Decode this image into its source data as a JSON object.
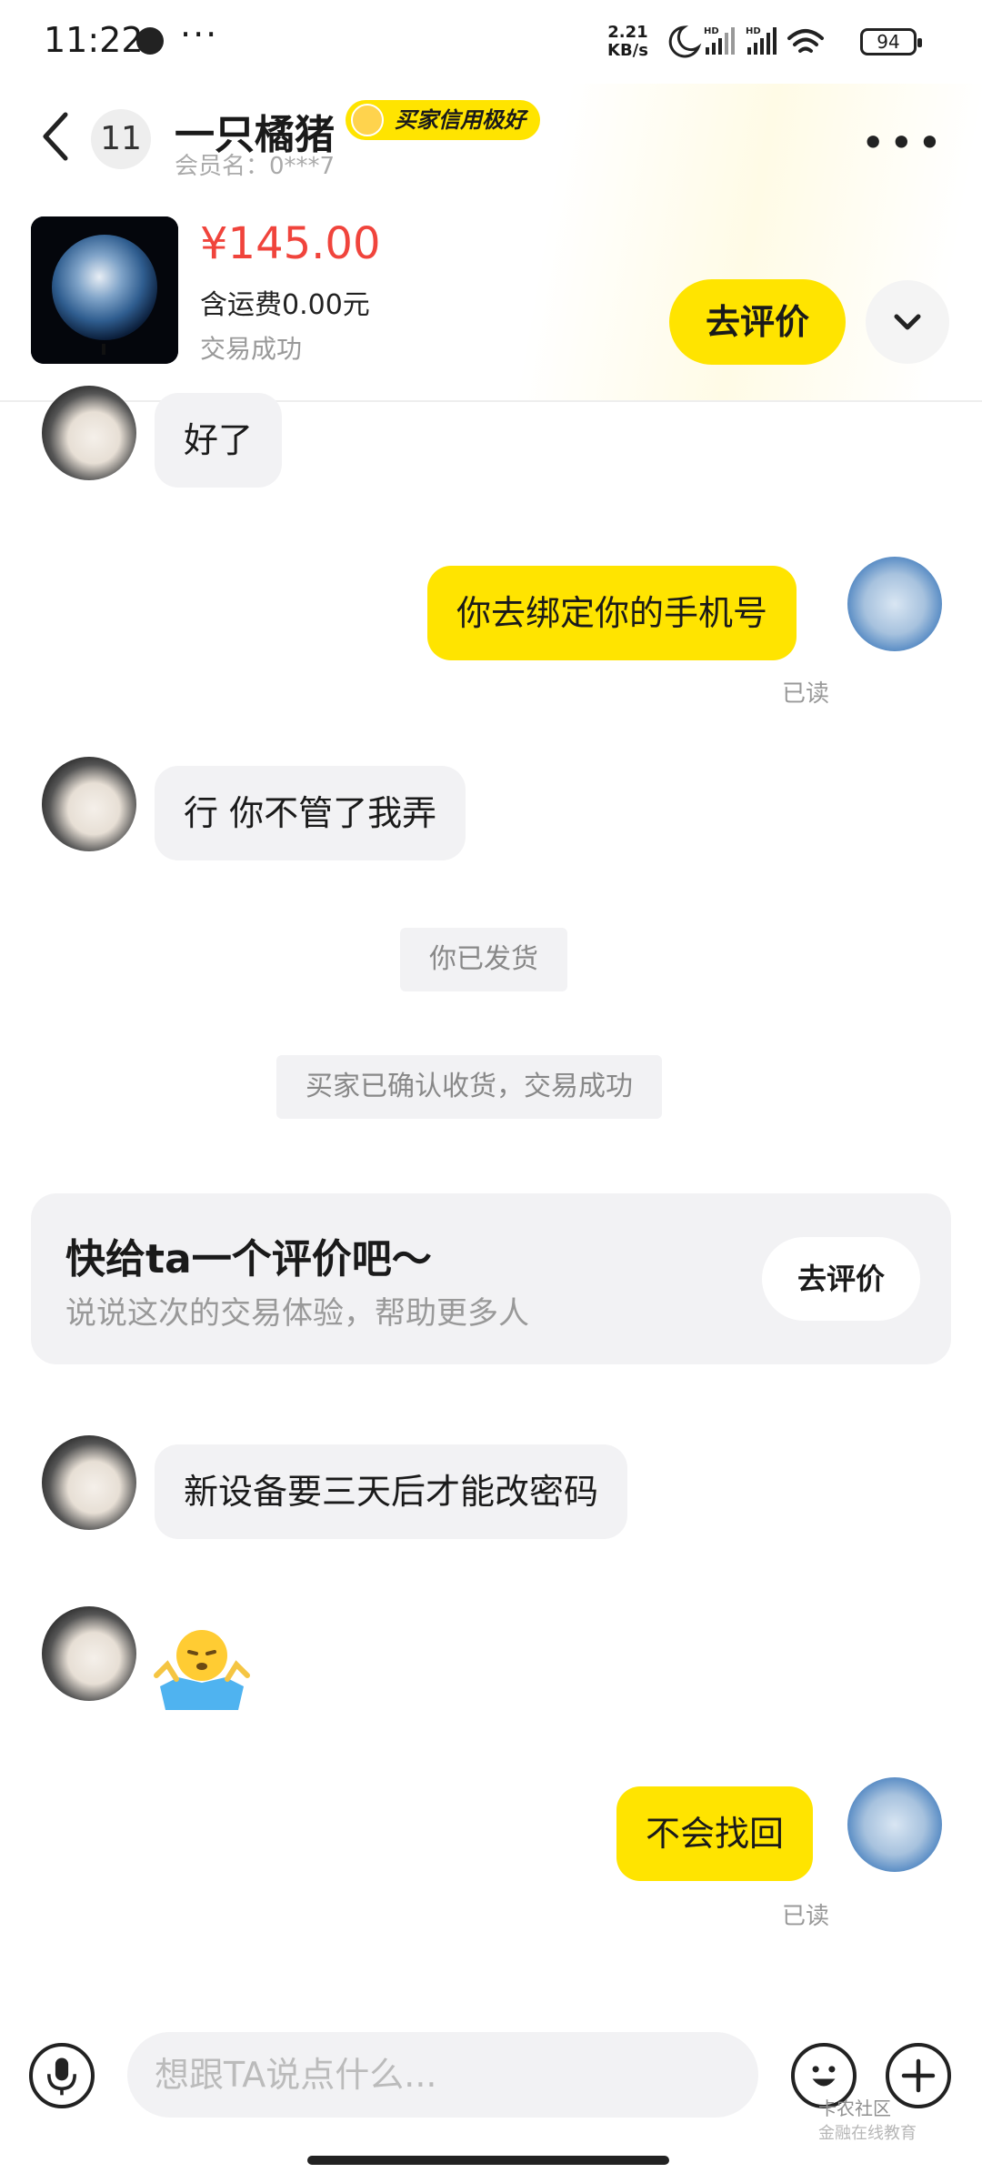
{
  "status_bar": {
    "time": "11:22",
    "more": "···",
    "speed_value": "2.21",
    "speed_unit": "KB/s",
    "battery": "94"
  },
  "header": {
    "unread_count": "11",
    "nickname": "一只橘猪",
    "credit_badge": "买家信用极好",
    "member_label": "会员名：0***7"
  },
  "product": {
    "price": "¥145.00",
    "shipping": "含运费0.00元",
    "status": "交易成功",
    "review_button": "去评价"
  },
  "messages": [
    {
      "side": "left",
      "text": "好了"
    },
    {
      "side": "right",
      "text": "你去绑定你的手机号",
      "read": "已读"
    },
    {
      "side": "left",
      "text": "行 你不管了我弄"
    },
    {
      "side": "system",
      "text": "你已发货"
    },
    {
      "side": "system",
      "text": "买家已确认收货，交易成功"
    },
    {
      "side": "left",
      "text": "新设备要三天后才能改密码"
    },
    {
      "side": "left",
      "type": "sticker",
      "icon": "shrug-emoji"
    },
    {
      "side": "right",
      "text": "不会找回",
      "read": "已读"
    }
  ],
  "review_card": {
    "title": "快给ta一个评价吧～",
    "subtitle": "说说这次的交易体验，帮助更多人",
    "button": "去评价"
  },
  "input": {
    "placeholder": "想跟TA说点什么..."
  },
  "watermark": {
    "main": "卡农社区",
    "sub": "金融在线教育"
  },
  "colors": {
    "accent_yellow": "#ffe400",
    "price_red": "#f0443c",
    "bubble_gray": "#f2f2f4"
  }
}
